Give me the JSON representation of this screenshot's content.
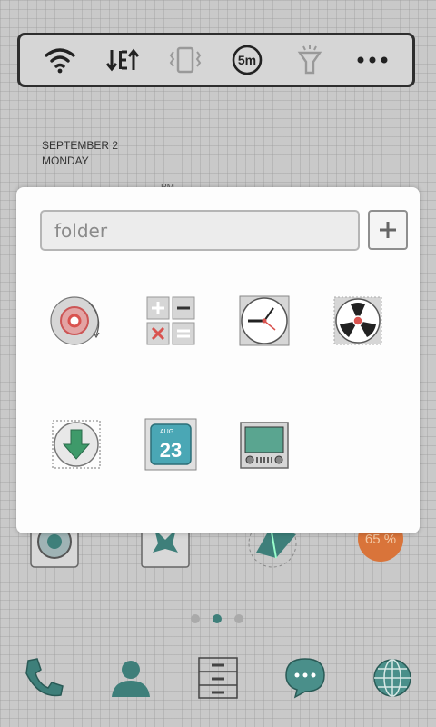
{
  "status_widget": {
    "items": [
      {
        "icon": "wifi-icon"
      },
      {
        "icon": "data-transfer-icon"
      },
      {
        "icon": "vibrate-icon"
      },
      {
        "icon": "timeout-icon",
        "label": "5m"
      },
      {
        "icon": "flashlight-icon"
      },
      {
        "icon": "more-icon"
      }
    ]
  },
  "clock_widget": {
    "date": "SEPTEMBER 2",
    "day": "MONDAY",
    "ampm": "PM"
  },
  "battery_widget": {
    "label": "65 %",
    "color": "#d9743a"
  },
  "folder": {
    "name_placeholder": "folder",
    "add_label": "+",
    "apps": [
      {
        "icon": "music-player-icon"
      },
      {
        "icon": "calculator-icon"
      },
      {
        "icon": "clock-icon"
      },
      {
        "icon": "fan-icon"
      },
      {
        "icon": "download-icon"
      },
      {
        "icon": "calendar-icon",
        "month": "AUG",
        "day": "23"
      },
      {
        "icon": "tv-icon"
      }
    ]
  },
  "pager": {
    "pages": 3,
    "current": 2
  },
  "dock": {
    "items": [
      {
        "icon": "phone-icon"
      },
      {
        "icon": "contacts-icon"
      },
      {
        "icon": "app-drawer-icon"
      },
      {
        "icon": "messaging-icon"
      },
      {
        "icon": "browser-icon"
      }
    ]
  },
  "colors": {
    "accent": "#3e7f7a",
    "icon_teal": "#4a8f8a",
    "record_red": "#d9534f"
  }
}
